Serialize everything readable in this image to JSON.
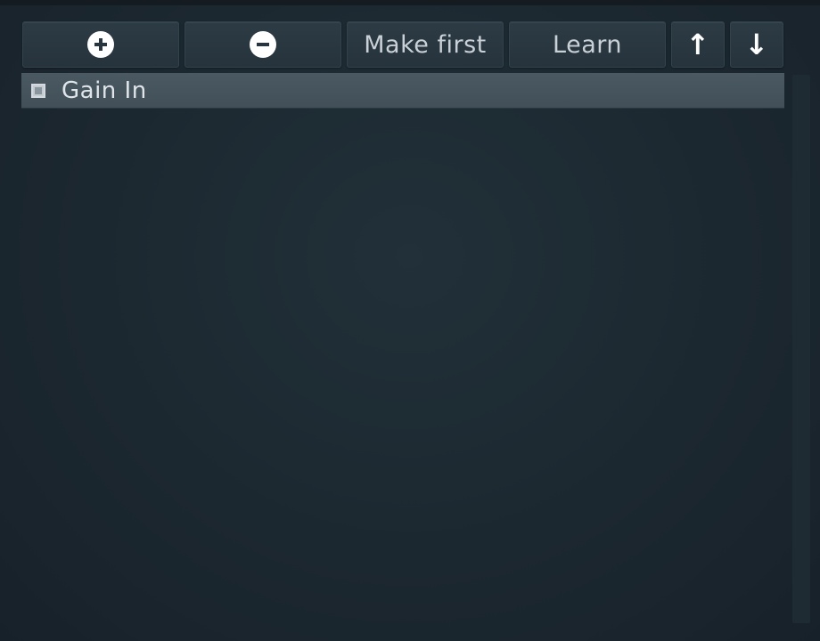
{
  "toolbar": {
    "add_icon": "plus-circle-icon",
    "remove_icon": "minus-circle-icon",
    "make_first_label": "Make first",
    "learn_label": "Learn",
    "up_label": "↑",
    "down_label": "↓"
  },
  "list": {
    "items": [
      {
        "label": "Gain In",
        "checked": true
      }
    ]
  },
  "colors": {
    "background": "#1c2830",
    "button": "#2a3741",
    "selected_row": "#465560",
    "text": "#dfe5e9"
  }
}
